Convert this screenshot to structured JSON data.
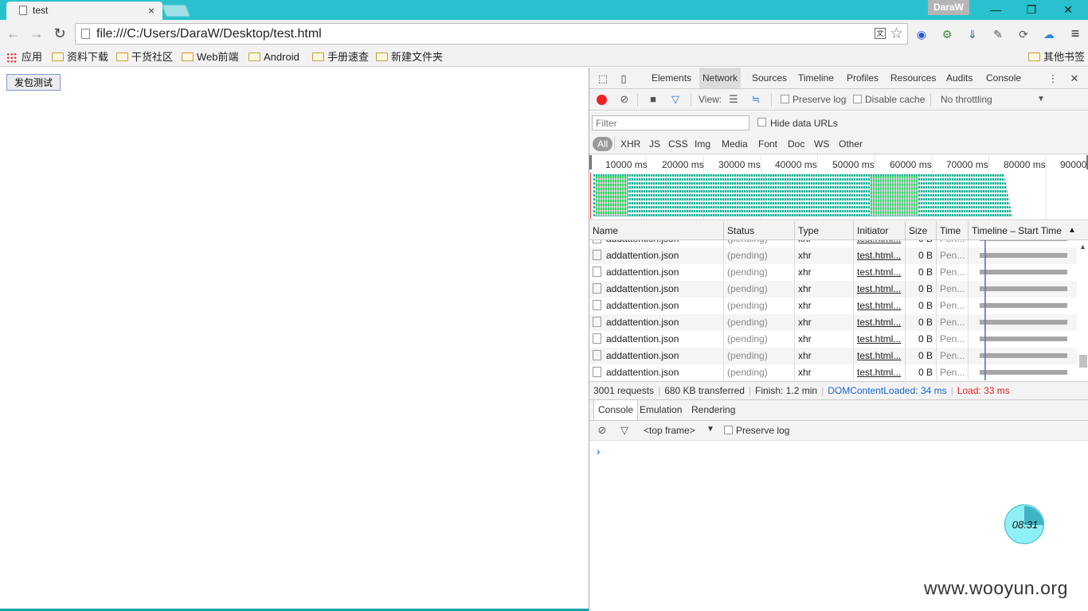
{
  "browser": {
    "tab_title": "test",
    "tab_close": "×",
    "profile_name": "DaraW",
    "window_controls": {
      "minimize": "—",
      "restore": "❐",
      "close": "✕"
    },
    "nav": {
      "back": "←",
      "forward": "→",
      "reload": "↻"
    },
    "url": "file:///C:/Users/DaraW/Desktop/test.html",
    "translate_icon": "文",
    "star_icon": "☆",
    "menu_icon": "≡"
  },
  "bookmarks": {
    "apps_label": "应用",
    "items": [
      "资料下载",
      "干货社区",
      "Web前端",
      "Android",
      "手册速查",
      "新建文件夹"
    ],
    "other": "其他书签"
  },
  "page": {
    "button_label": "发包测试"
  },
  "devtools": {
    "tabs": [
      "Elements",
      "Network",
      "Sources",
      "Timeline",
      "Profiles",
      "Resources",
      "Audits",
      "Console"
    ],
    "active_tab": "Network",
    "close": "✕",
    "more": "⋮",
    "toolbar": {
      "view_label": "View:",
      "preserve_log": "Preserve log",
      "disable_cache": "Disable cache",
      "throttling": "No throttling",
      "throttling_arrow": "▼"
    },
    "filter": {
      "placeholder": "Filter",
      "hide_data_urls": "Hide data URLs"
    },
    "types": [
      "All",
      "XHR",
      "JS",
      "CSS",
      "Img",
      "Media",
      "Font",
      "Doc",
      "WS",
      "Other"
    ],
    "overview_ticks": [
      "10000 ms",
      "20000 ms",
      "30000 ms",
      "40000 ms",
      "50000 ms",
      "60000 ms",
      "70000 ms",
      "80000 ms",
      "90000"
    ],
    "columns": [
      "Name",
      "Status",
      "Type",
      "Initiator",
      "Size",
      "Time",
      "Timeline – Start Time"
    ],
    "sort_indicator": "▲",
    "rows": [
      {
        "name": "addattention.json",
        "status": "(pending)",
        "type": "xhr",
        "initiator": "test.html...",
        "size": "0 B",
        "time": "Pen..."
      },
      {
        "name": "addattention.json",
        "status": "(pending)",
        "type": "xhr",
        "initiator": "test.html...",
        "size": "0 B",
        "time": "Pen..."
      },
      {
        "name": "addattention.json",
        "status": "(pending)",
        "type": "xhr",
        "initiator": "test.html...",
        "size": "0 B",
        "time": "Pen..."
      },
      {
        "name": "addattention.json",
        "status": "(pending)",
        "type": "xhr",
        "initiator": "test.html...",
        "size": "0 B",
        "time": "Pen..."
      },
      {
        "name": "addattention.json",
        "status": "(pending)",
        "type": "xhr",
        "initiator": "test.html...",
        "size": "0 B",
        "time": "Pen..."
      },
      {
        "name": "addattention.json",
        "status": "(pending)",
        "type": "xhr",
        "initiator": "test.html...",
        "size": "0 B",
        "time": "Pen..."
      },
      {
        "name": "addattention.json",
        "status": "(pending)",
        "type": "xhr",
        "initiator": "test.html...",
        "size": "0 B",
        "time": "Pen..."
      },
      {
        "name": "addattention.json",
        "status": "(pending)",
        "type": "xhr",
        "initiator": "test.html...",
        "size": "0 B",
        "time": "Pen..."
      },
      {
        "name": "addattention.json",
        "status": "(pending)",
        "type": "xhr",
        "initiator": "test.html...",
        "size": "0 B",
        "time": "Pen..."
      },
      {
        "name": "addattention.json",
        "status": "(pending)",
        "type": "xhr",
        "initiator": "test.html...",
        "size": "0 B",
        "time": "Pen..."
      }
    ],
    "summary": {
      "requests": "3001 requests",
      "transferred": "680 KB transferred",
      "finish": "Finish: 1.2 min",
      "dom_content_loaded": "DOMContentLoaded: 34 ms",
      "load": "Load: 33 ms"
    },
    "drawer_tabs": [
      "Console",
      "Emulation",
      "Rendering"
    ],
    "console": {
      "frame": "<top frame>",
      "frame_arrow": "▼",
      "preserve_log": "Preserve log",
      "prompt": "›"
    }
  },
  "overlay": {
    "clock_time": "08:31",
    "watermark": "www.wooyun.org"
  }
}
